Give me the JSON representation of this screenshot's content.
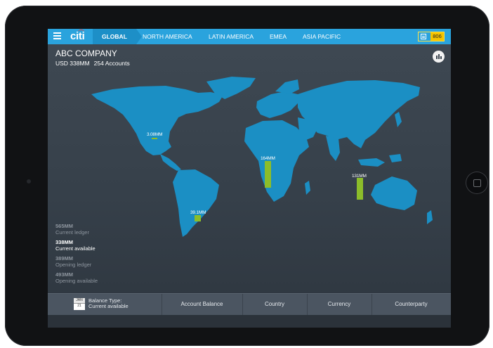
{
  "nav": {
    "logo": "citi",
    "tabs": [
      "GLOBAL",
      "NORTH AMERICA",
      "LATIN AMERICA",
      "EMEA",
      "ASIA PACIFIC"
    ],
    "badge_count": "806"
  },
  "header": {
    "company": "ABC COMPANY",
    "total": "USD 338MM",
    "accounts": "254 Accounts"
  },
  "map_markers": [
    {
      "label": "3.08MM",
      "value": 3.08
    },
    {
      "label": "39.1MM",
      "value": 39.1
    },
    {
      "label": "164MM",
      "value": 164
    },
    {
      "label": "131MM",
      "value": 131
    }
  ],
  "stats": [
    {
      "value": "565MM",
      "label": "Current ledger",
      "active": false
    },
    {
      "value": "338MM",
      "label": "Current available",
      "active": true
    },
    {
      "value": "389MM",
      "label": "Opening ledger",
      "active": false
    },
    {
      "value": "493MM",
      "label": "Opening available",
      "active": false
    }
  ],
  "bottom": {
    "calendar_month": "JAN",
    "calendar_day": "21",
    "balance_type_label": "Balance Type:",
    "balance_type_value": "Current available",
    "tabs": [
      "Account Balance",
      "Country",
      "Currency",
      "Counterparty"
    ]
  },
  "colors": {
    "accent": "#2aa3dd",
    "marker": "#8cbd2a",
    "badge": "#f5c400",
    "map_fill": "#1b8fc4"
  },
  "icons": [
    "menu-icon",
    "list-icon",
    "bar-chart-icon",
    "calendar-icon"
  ]
}
